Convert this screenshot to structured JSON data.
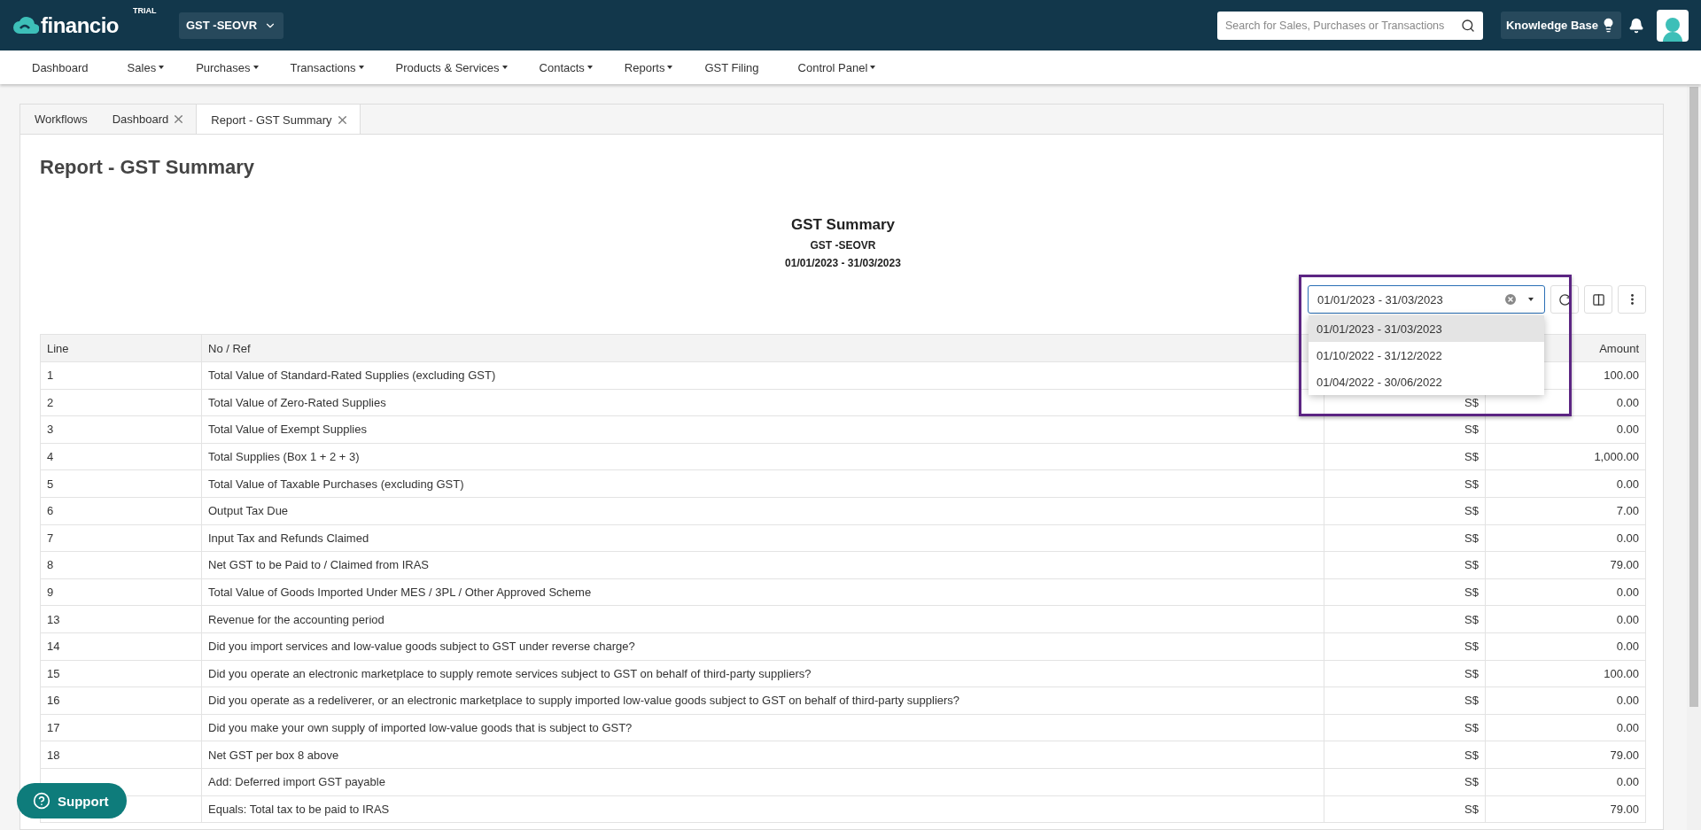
{
  "header": {
    "brand": "financio",
    "badge": "TRIAL",
    "company": "GST -SEOVR",
    "search": {
      "placeholder": "Search for Sales, Purchases or Transactions"
    },
    "knowledge_base": "Knowledge Base"
  },
  "nav": [
    {
      "label": "Dashboard",
      "caret": false
    },
    {
      "label": "Sales",
      "caret": true
    },
    {
      "label": "Purchases",
      "caret": true
    },
    {
      "label": "Transactions",
      "caret": true
    },
    {
      "label": "Products & Services",
      "caret": true
    },
    {
      "label": "Contacts",
      "caret": true
    },
    {
      "label": "Reports",
      "caret": true
    },
    {
      "label": "GST Filing",
      "caret": false
    },
    {
      "label": "Control Panel",
      "caret": true
    }
  ],
  "tabs": [
    {
      "label": "Workflows",
      "selected": false,
      "closable": false
    },
    {
      "label": "Dashboard",
      "selected": false,
      "closable": true
    },
    {
      "label": "Report - GST Summary",
      "selected": true,
      "closable": true
    }
  ],
  "page_title": "Report - GST Summary",
  "report": {
    "title": "GST Summary",
    "company": "GST -SEOVR",
    "period": "01/01/2023 - 31/03/2023"
  },
  "period_select": {
    "value": "01/01/2023 - 31/03/2023",
    "expanded": true,
    "options": [
      {
        "label": "01/01/2023 - 31/03/2023",
        "selected": true
      },
      {
        "label": "01/10/2022 - 31/12/2022",
        "selected": false
      },
      {
        "label": "01/04/2022 - 30/06/2022",
        "selected": false
      }
    ]
  },
  "table": {
    "columns": [
      "Line",
      "No / Ref",
      "Amount"
    ],
    "rows": [
      {
        "line": "1",
        "ref": "Total Value of Standard-Rated Supplies (excluding GST)",
        "amount": "100.00"
      },
      {
        "line": "2",
        "ref": "Total Value of Zero-Rated Supplies",
        "currency": "S$",
        "amount": "0.00"
      },
      {
        "line": "3",
        "ref": "Total Value of Exempt Supplies",
        "currency": "S$",
        "amount": "0.00"
      },
      {
        "line": "4",
        "ref": "Total Supplies (Box 1 + 2 + 3)",
        "currency": "S$",
        "amount": "1,000.00"
      },
      {
        "line": "5",
        "ref": "Total Value of Taxable Purchases (excluding GST)",
        "currency": "S$",
        "amount": "0.00"
      },
      {
        "line": "6",
        "ref": "Output Tax Due",
        "currency": "S$",
        "amount": "7.00"
      },
      {
        "line": "7",
        "ref": "Input Tax and Refunds Claimed",
        "currency": "S$",
        "amount": "0.00"
      },
      {
        "line": "8",
        "ref": "Net GST to be Paid to / Claimed from IRAS",
        "currency": "S$",
        "amount": "79.00"
      },
      {
        "line": "9",
        "ref": "Total Value of Goods Imported Under MES / 3PL / Other Approved Scheme",
        "currency": "S$",
        "amount": "0.00"
      },
      {
        "line": "13",
        "ref": "Revenue for the accounting period",
        "currency": "S$",
        "amount": "0.00"
      },
      {
        "line": "14",
        "ref": "Did you import services and low-value goods subject to GST under reverse charge?",
        "currency": "S$",
        "amount": "0.00"
      },
      {
        "line": "15",
        "ref": "Did you operate an electronic marketplace to supply remote services subject to GST on behalf of third-party suppliers?",
        "currency": "S$",
        "amount": "100.00"
      },
      {
        "line": "16",
        "ref": "Did you operate as a redeliverer, or an electronic marketplace to supply imported low-value goods subject to GST on behalf of third-party suppliers?",
        "currency": "S$",
        "amount": "0.00"
      },
      {
        "line": "17",
        "ref": "Did you make your own supply of imported low-value goods that is subject to GST?",
        "currency": "S$",
        "amount": "0.00"
      },
      {
        "line": "18",
        "ref": "Net GST per box 8 above",
        "currency": "S$",
        "amount": "79.00"
      },
      {
        "ref": "Add: Deferred import GST payable",
        "currency": "S$",
        "amount": "0.00"
      },
      {
        "ref": "Equals: Total tax to be paid to IRAS",
        "currency": "S$",
        "amount": "79.00"
      }
    ]
  },
  "support": "Support"
}
